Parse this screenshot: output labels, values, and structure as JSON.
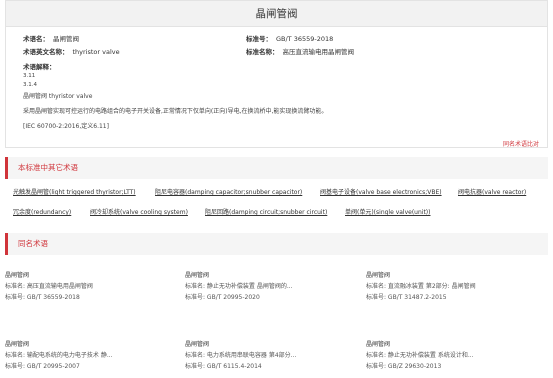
{
  "term": {
    "title": "晶闸管阀",
    "term_cn_label": "术语名：",
    "term_cn": "晶闸管阀",
    "term_en_label": "术语英文名称：",
    "term_en": "thyristor valve",
    "std_no_label": "标准号：",
    "std_no": "GB/T 36559-2018",
    "std_name_label": "标准名称：",
    "std_name": "高压直流输电用晶闸管阀",
    "explain_label": "术语解释：",
    "clause_1": "3.11",
    "clause_2": "3.1.4",
    "explain_term": "晶闸管阀 thyristor valve",
    "explain_text": "采用晶闸管实现可控运行的电路组合的电子开关设备,正常情况下仅单向(正向)导电,在换流桥中,能实现换流臂功能。",
    "explain_source": "[IEC 60700-2:2016,定义6.11]",
    "compare_link": "同名术语比对"
  },
  "other_terms": {
    "heading": "本标准中其它术语",
    "row1": [
      "光触发晶闸管(light triggered thyristor;LTT)",
      "阻尼电容器(damping capacitor;snubber capacitor)",
      "阀基电子设备(valve base electronics;VBE)",
      "阀电抗器(valve reactor)"
    ],
    "row2": [
      "冗余度(redundancy)",
      "阀冷却系统(valve cooling system)",
      "阻尼回路(damping circuit;snubber circuit)",
      "单阀(单元)(single valve(unit))"
    ]
  },
  "same_terms": {
    "heading": "同名术语",
    "cards": [
      {
        "title": "晶闸管阀",
        "name_line": "标准名: 高压直流输电用晶闸管阀",
        "no_line": "标准号: GB/T 36559-2018"
      },
      {
        "title": "晶闸管阀",
        "name_line": "标准名: 静止无功补偿装置  晶闸管阀的...",
        "no_line": "标准号: GB/T 20995-2020"
      },
      {
        "title": "晶闸管阀",
        "name_line": "标准名: 直流融冰装置  第2部分: 晶闸管阀",
        "no_line": "标准号: GB/T 31487.2-2015"
      },
      {
        "title": "晶闸管阀",
        "name_line": "标准名: 输配电系统的电力电子技术  静...",
        "no_line": "标准号: GB/T 20995-2007"
      },
      {
        "title": "晶闸管阀",
        "name_line": "标准名: 电力系统用串联电容器  第4部分...",
        "no_line": "标准号: GB/T 6115.4-2014"
      },
      {
        "title": "晶闸管阀",
        "name_line": "标准名: 静止无功补偿装置  系统设计和...",
        "no_line": "标准号: GB/Z 29630-2013"
      }
    ]
  }
}
